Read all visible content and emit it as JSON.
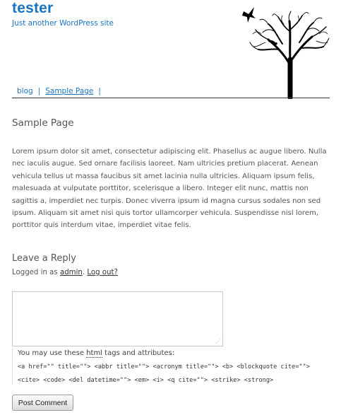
{
  "site": {
    "title": "tester",
    "tagline": "Just another WordPress site"
  },
  "nav": {
    "items": [
      "blog",
      "Sample Page"
    ],
    "separator": "|"
  },
  "page": {
    "title": "Sample Page",
    "body": "Lorem ipsum dolor sit amet, consectetur adipiscing elit. Phasellus ac augue libero. Nulla nec iaculis augue. Sed ornare facilisis laoreet. Nam ultricies pretium placerat. Aenean vehicula tellus ut massa faucibus sit amet lacinia nulla ultricies. Aliquam ipsum felis, malesuada at vulputate porttitor, scelerisque a libero. Integer elit nunc, mattis non sagittis a, imperdiet nec turpis. Donec viverra ipsum id magna cursus sodales non sed ipsum. Aliquam sit amet nisi quis tortor ullamcorper vehicula. Suspendisse nisl lorem, porttitor quis interdum vitae, imperdiet vitae felis."
  },
  "reply": {
    "heading": "Leave a Reply",
    "logged_in_prefix": "Logged in as ",
    "user": "admin",
    "after_user": ". ",
    "logout": "Log out?",
    "comment_value": "",
    "allowed_intro_1": "You may use these ",
    "allowed_html_word": "html",
    "allowed_intro_2": " tags and attributes:",
    "allowed_tags": "<a href=\"\" title=\"\"> <abbr title=\"\"> <acronym title=\"\"> <b> <blockquote cite=\"\"> <cite> <code> <del datetime=\"\"> <em> <i> <q cite=\"\"> <strike> <strong>",
    "submit_label": "Post Comment",
    "resize_glyph": "⋰"
  },
  "colors": {
    "link": "#1a73c0",
    "text": "#555555",
    "rule": "#333333"
  },
  "icons": {
    "header": "tree-with-birds-icon"
  }
}
